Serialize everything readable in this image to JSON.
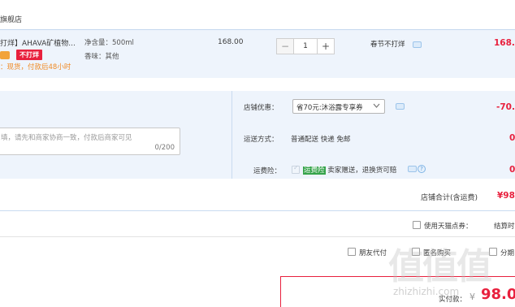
{
  "shop": {
    "title": "旗舰店"
  },
  "item": {
    "name": "打烊】AHAVA矿植物...",
    "badge": "不打烊",
    "ship_note": "：现货，付款后48小时",
    "spec_volume": "净含量：500ml",
    "spec_scent": "香味：其他",
    "price": "168.00",
    "quantity": "1",
    "minus": "−",
    "plus": "+",
    "holiday_label": "春节不打烊",
    "subtotal": "168."
  },
  "message": {
    "placeholder": "填，请先和商家协商一致，付款后商家可见",
    "counter": "0/200"
  },
  "options": {
    "coupon_label": "店铺优惠：",
    "coupon_value": "省70元:沐浴露专享券",
    "coupon_amount": "-70.",
    "delivery_label": "运送方式：",
    "delivery_value": "普通配送 快递 免邮",
    "delivery_amount": "0",
    "insurance_label": "运费险：",
    "insurance_tag": "运费险",
    "insurance_text": "卖家赠送，退换货可赔",
    "insurance_amount": "0",
    "help_glyph": "?"
  },
  "shop_total": {
    "label": "店铺合计(含运费)",
    "amount": "¥98."
  },
  "points": {
    "label": "使用天猫点券：",
    "trailing": "结算时"
  },
  "payment": {
    "friend_pay": "朋友代付",
    "anonymous": "匿名购买",
    "installment": "分期",
    "actual_label": "实付款：",
    "currency": "¥",
    "amount": "98.0"
  },
  "watermark": {
    "glyphs": "值值值",
    "domain": "zhizhizhi.com"
  },
  "colors": {
    "accent_red": "#e8203d",
    "panel_blue": "#eef4fc",
    "ship_orange": "#f08a24"
  }
}
